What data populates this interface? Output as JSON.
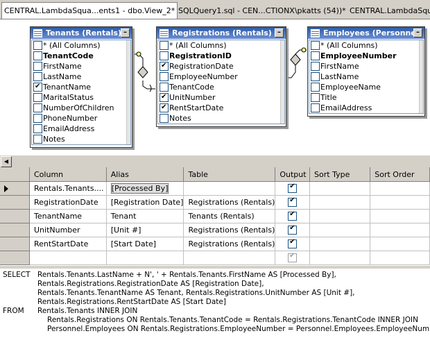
{
  "tabs": [
    {
      "label": "CENTRAL.LambdaSqua...ents1 - dbo.View_2*",
      "active": true
    },
    {
      "label": "SQLQuery1.sql - CEN...CTIONX\\pkatts (54))*",
      "active": false
    },
    {
      "label": "CENTRAL.LambdaSqua...",
      "active": false
    }
  ],
  "tables": [
    {
      "title": "Tenants (Rentals)",
      "columns": [
        {
          "name": "* (All Columns)",
          "checked": false,
          "key": false
        },
        {
          "name": "TenantCode",
          "checked": false,
          "key": true
        },
        {
          "name": "FirstName",
          "checked": false,
          "key": false
        },
        {
          "name": "LastName",
          "checked": false,
          "key": false
        },
        {
          "name": "TenantName",
          "checked": true,
          "key": false
        },
        {
          "name": "MaritalStatus",
          "checked": false,
          "key": false
        },
        {
          "name": "NumberOfChildren",
          "checked": false,
          "key": false
        },
        {
          "name": "PhoneNumber",
          "checked": false,
          "key": false
        },
        {
          "name": "EmailAddress",
          "checked": false,
          "key": false
        },
        {
          "name": "Notes",
          "checked": false,
          "key": false
        }
      ]
    },
    {
      "title": "Registrations (Rentals)",
      "columns": [
        {
          "name": "* (All Columns)",
          "checked": false,
          "key": false
        },
        {
          "name": "RegistrationID",
          "checked": false,
          "key": true
        },
        {
          "name": "RegistrationDate",
          "checked": true,
          "key": false
        },
        {
          "name": "EmployeeNumber",
          "checked": false,
          "key": false
        },
        {
          "name": "TenantCode",
          "checked": false,
          "key": false
        },
        {
          "name": "UnitNumber",
          "checked": true,
          "key": false
        },
        {
          "name": "RentStartDate",
          "checked": true,
          "key": false
        },
        {
          "name": "Notes",
          "checked": false,
          "key": false
        }
      ]
    },
    {
      "title": "Employees (Personnel)",
      "columns": [
        {
          "name": "* (All Columns)",
          "checked": false,
          "key": false
        },
        {
          "name": "EmployeeNumber",
          "checked": false,
          "key": true
        },
        {
          "name": "FirstName",
          "checked": false,
          "key": false
        },
        {
          "name": "LastName",
          "checked": false,
          "key": false
        },
        {
          "name": "EmployeeName",
          "checked": false,
          "key": false
        },
        {
          "name": "Title",
          "checked": false,
          "key": false
        },
        {
          "name": "EmailAddress",
          "checked": false,
          "key": false
        }
      ]
    }
  ],
  "grid": {
    "headers": [
      "Column",
      "Alias",
      "Table",
      "Output",
      "Sort Type",
      "Sort Order"
    ],
    "rows": [
      {
        "column": "Rentals.Tenants....",
        "alias": "[Processed By]",
        "table": "",
        "output": true,
        "sortType": "",
        "sortOrder": "",
        "current": true
      },
      {
        "column": "RegistrationDate",
        "alias": "[Registration Date]",
        "table": "Registrations (Rentals)",
        "output": true,
        "sortType": "",
        "sortOrder": "",
        "current": false
      },
      {
        "column": "TenantName",
        "alias": "Tenant",
        "table": "Tenants (Rentals)",
        "output": true,
        "sortType": "",
        "sortOrder": "",
        "current": false
      },
      {
        "column": "UnitNumber",
        "alias": "[Unit #]",
        "table": "Registrations (Rentals)",
        "output": true,
        "sortType": "",
        "sortOrder": "",
        "current": false
      },
      {
        "column": "RentStartDate",
        "alias": "[Start Date]",
        "table": "Registrations (Rentals)",
        "output": true,
        "sortType": "",
        "sortOrder": "",
        "current": false
      },
      {
        "column": "",
        "alias": "",
        "table": "",
        "output": "disabled",
        "sortType": "",
        "sortOrder": "",
        "current": false
      }
    ]
  },
  "sql": {
    "kw_select": "SELECT",
    "kw_from": "FROM",
    "select_lines": [
      "Rentals.Tenants.LastName + N', ' + Rentals.Tenants.FirstName AS [Processed By],",
      "Rentals.Registrations.RegistrationDate AS [Registration Date],",
      "Rentals.Tenants.TenantName AS Tenant, Rentals.Registrations.UnitNumber AS [Unit #],",
      "Rentals.Registrations.RentStartDate AS [Start Date]"
    ],
    "from_lines": [
      "Rentals.Tenants INNER JOIN",
      "Rentals.Registrations ON Rentals.Tenants.TenantCode = Rentals.Registrations.TenantCode INNER JOIN",
      "Personnel.Employees ON Rentals.Registrations.EmployeeNumber = Personnel.Employees.EmployeeNumber"
    ]
  }
}
